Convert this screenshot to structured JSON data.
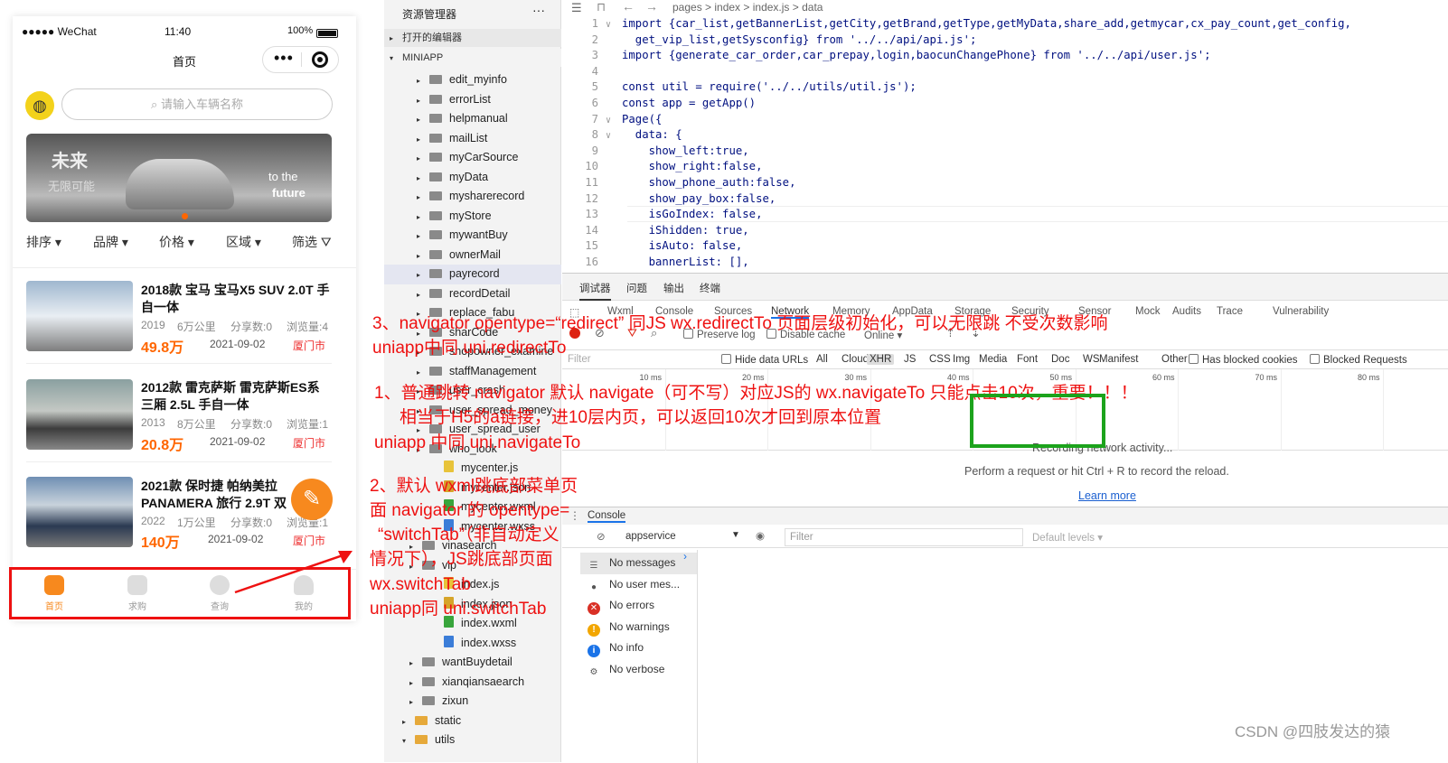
{
  "phone": {
    "status_carrier": "●●●●● WeChat",
    "status_time": "11:40",
    "status_battery": "100%",
    "nav_title": "首页",
    "capsule_dots": "•••",
    "search_placeholder": "请输入车辆名称",
    "banner": {
      "t1": "未来",
      "t2": "无限可能",
      "t3": "to  the",
      "t4": "future"
    },
    "filters": [
      "排序",
      "品牌",
      "价格",
      "区域",
      "筛选"
    ],
    "cars": [
      {
        "title": "2018款 宝马 宝马X5 SUV 2.0T 手自一体",
        "year": "2019",
        "km": "6万公里",
        "share": "分享数:0",
        "views": "浏览量:4",
        "price": "49.8万",
        "date": "2021-09-02",
        "city": "厦门市"
      },
      {
        "title": "2012款 雷克萨斯 雷克萨斯ES系 三厢 2.5L 手自一体",
        "year": "2013",
        "km": "8万公里",
        "share": "分享数:0",
        "views": "浏览量:1",
        "price": "20.8万",
        "date": "2021-09-02",
        "city": "厦门市"
      },
      {
        "title": "2021款 保时捷 帕纳美拉 PANAMERA 旅行 2.9T 双",
        "year": "2022",
        "km": "1万公里",
        "share": "分享数:0",
        "views": "浏览量:1",
        "price": "140万",
        "date": "2021-09-02",
        "city": "厦门市"
      }
    ],
    "tabs": [
      "首页",
      "求购",
      "查询",
      "我的"
    ]
  },
  "tree": {
    "header": "资源管理器",
    "more": "···",
    "open_editors": "打开的编辑器",
    "project": "MINIAPP",
    "items": [
      "edit_myinfo",
      "errorList",
      "helpmanual",
      "mailList",
      "myCarSource",
      "myData",
      "mysharerecord",
      "myStore",
      "mywantBuy",
      "ownerMail",
      "payrecord",
      "recordDetail",
      "replace_fabu",
      "sharCode",
      "shopowner_examine",
      "staffManagement",
      "user_crash",
      "user_spread_money",
      "user_spread_user",
      "who_look",
      "mycenter.js",
      "mycenter.json",
      "mycenter.wxml",
      "mycenter.wxss",
      "vinasearch",
      "vip",
      "index.js",
      "index.json",
      "index.wxml",
      "index.wxss",
      "wantBuydetail",
      "xianqiansaearch",
      "zixun",
      "static",
      "utils"
    ]
  },
  "editor": {
    "breadcrumb": "pages  >  index  >  index.js  >  data",
    "lines": [
      {
        "n": "1",
        "code": "import {car_list,getBannerList,getCity,getBrand,getType,getMyData,share_add,getmycar,cx_pay_count,get_config,"
      },
      {
        "n": "2",
        "code": "  get_vip_list,getSysconfig} from '../../api/api.js';"
      },
      {
        "n": "3",
        "code": "import {generate_car_order,car_prepay,login,baocunChangePhone} from '../../api/user.js';"
      },
      {
        "n": "4",
        "code": ""
      },
      {
        "n": "5",
        "code": "const util = require('../../utils/util.js');"
      },
      {
        "n": "6",
        "code": "const app = getApp()"
      },
      {
        "n": "7",
        "code": "Page({"
      },
      {
        "n": "8",
        "code": "  data: {"
      },
      {
        "n": "9",
        "code": "    show_left:true,"
      },
      {
        "n": "10",
        "code": "    show_right:false,"
      },
      {
        "n": "11",
        "code": "    show_phone_auth:false,"
      },
      {
        "n": "12",
        "code": "    show_pay_box:false,"
      },
      {
        "n": "13",
        "code": "    isGoIndex: false,"
      },
      {
        "n": "14",
        "code": "    iShidden: true,"
      },
      {
        "n": "15",
        "code": "    isAuto: false,"
      },
      {
        "n": "16",
        "code": "    bannerList: [],"
      }
    ]
  },
  "devtools": {
    "tabs": [
      "调试器",
      "问题",
      "输出",
      "终端"
    ],
    "panels": [
      "Wxml",
      "Console",
      "Sources",
      "Network",
      "Memory",
      "AppData",
      "Storage",
      "Security",
      "Sensor",
      "Mock",
      "Audits",
      "Trace",
      "Vulnerability"
    ],
    "preserve_log": "Preserve log",
    "disable_cache": "Disable cache",
    "online": "Online",
    "filter_placeholder": "Filter",
    "hide_data_urls": "Hide data URLs",
    "types": [
      "All",
      "Cloud",
      "XHR",
      "JS",
      "CSS",
      "Img",
      "Media",
      "Font",
      "Doc",
      "WS",
      "Manifest",
      "Other"
    ],
    "has_blocked": "Has blocked cookies",
    "blocked_req": "Blocked Requests",
    "ticks": [
      "10 ms",
      "20 ms",
      "30 ms",
      "40 ms",
      "50 ms",
      "60 ms",
      "70 ms",
      "80 ms"
    ],
    "recording": "Recording network activity...",
    "perform": "Perform a request or hit Ctrl + R to record the reload.",
    "learn_more": "Learn more",
    "console_tab": "Console",
    "context": "appservice",
    "filter2": "Filter",
    "levels": "Default levels ▾",
    "messages": [
      "No messages",
      "No user mes...",
      "No errors",
      "No warnings",
      "No info",
      "No verbose"
    ]
  },
  "annotations": {
    "a3_l1": "3、navigator opentype=“redirect” 同JS wx.redirectTo 页面层级初始化，可以无限跳  不受次数影响",
    "a3_l2": "uniapp中同 uni.redirectTo",
    "a1_l1": "1、普通跳转 navigator  默认 navigate（可不写）对应JS的 wx.navigateTo  只能点击10次，重要！！！",
    "a1_l2": "相当于H5的a链接，进10层内页，可以返回10次才回到原本位置",
    "a1_l3": "uniapp 中同  uni.navigateTo",
    "a2_l1": "2、默认 wxml跳底部菜单页",
    "a2_l2": "面 navigator 的 opentype=",
    "a2_l3": "“switchTab”（非自动定义",
    "a2_l4": "情况下），JS跳底部页面",
    "a2_l5": "wx.switchTab",
    "a2_l6": "uniapp同 uni.switchTab"
  },
  "watermark": "CSDN @四肢发达的猿"
}
